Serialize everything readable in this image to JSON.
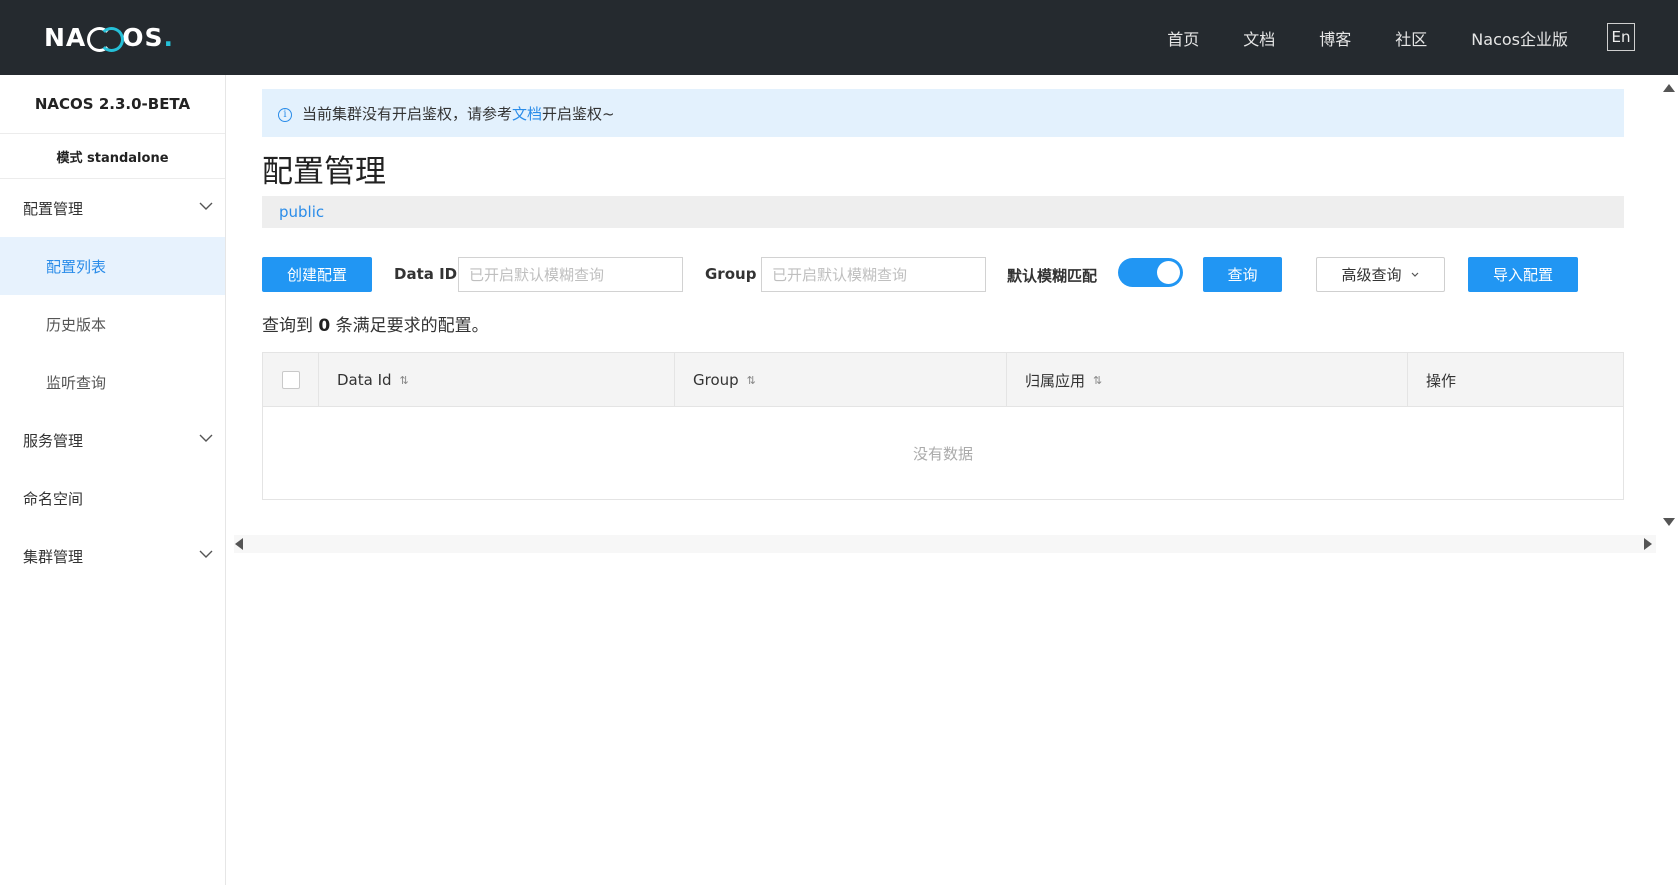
{
  "header": {
    "logo": {
      "pre": "NA",
      "post": "OS",
      "dot": "."
    },
    "nav": [
      "首页",
      "文档",
      "博客",
      "社区",
      "Nacos企业版"
    ],
    "lang_button": "En"
  },
  "sidebar": {
    "version": "NACOS 2.3.0-BETA",
    "mode": "模式 standalone",
    "groups": [
      {
        "label": "配置管理",
        "expanded": true,
        "items": [
          "配置列表",
          "历史版本",
          "监听查询"
        ],
        "active": "配置列表"
      },
      {
        "label": "服务管理",
        "expanded": false
      },
      {
        "label": "命名空间"
      },
      {
        "label": "集群管理",
        "expanded": false
      }
    ]
  },
  "alert": {
    "icon": "info-icon",
    "text_before": "当前集群没有开启鉴权，请参考",
    "link": "文档",
    "text_after": "开启鉴权~"
  },
  "page": {
    "title": "配置管理",
    "namespace": "public"
  },
  "toolbar": {
    "create_button": "创建配置",
    "data_id_label": "Data ID",
    "data_id_placeholder": "已开启默认模糊查询",
    "group_label": "Group",
    "group_placeholder": "已开启默认模糊查询",
    "fuzzy_label": "默认模糊匹配",
    "fuzzy_enabled": true,
    "query_button": "查询",
    "advanced_button": "高级查询",
    "import_button": "导入配置"
  },
  "result": {
    "prefix": "查询到",
    "count": "0",
    "suffix": "条满足要求的配置。"
  },
  "table": {
    "columns": [
      "Data Id",
      "Group",
      "归属应用",
      "操作"
    ],
    "empty_text": "没有数据"
  },
  "colors": {
    "topbar": "#252a2f",
    "accent": "#2196f3",
    "logo_accent": "#25c0d8",
    "active_bg": "#e7f2fd"
  }
}
